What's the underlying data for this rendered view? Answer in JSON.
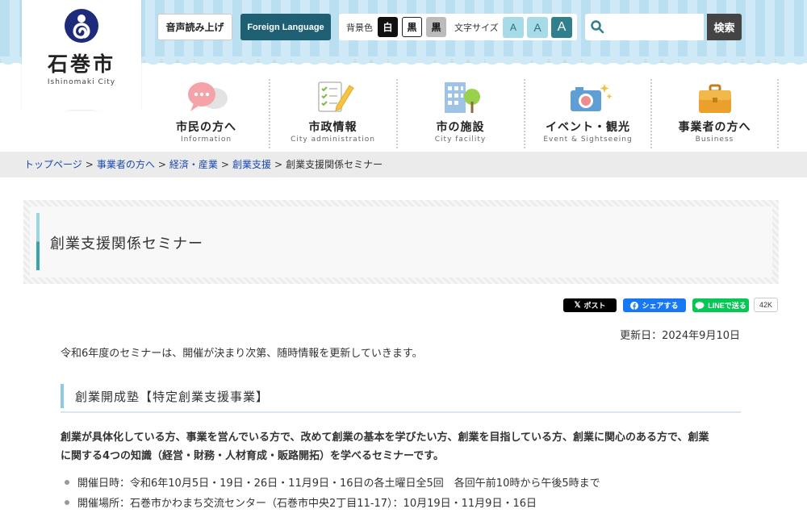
{
  "site": {
    "name": "石巻市",
    "name_en": "Ishinomaki City"
  },
  "toolbar": {
    "voice_label": "音声読み上げ",
    "foreign_label": "Foreign Language",
    "bg_label": "背景色",
    "bg_options": [
      "白",
      "黒",
      "黒"
    ],
    "size_label": "文字サイズ",
    "size_options": [
      "A",
      "A",
      "A"
    ],
    "search_placeholder": "",
    "search_button": "検索"
  },
  "nav": [
    {
      "label": "市民の方へ",
      "sub": "Information",
      "icon": "speech-bubbles-icon"
    },
    {
      "label": "市政情報",
      "sub": "City administration",
      "icon": "checklist-pencil-icon"
    },
    {
      "label": "市の施設",
      "sub": "City facility",
      "icon": "building-tree-icon"
    },
    {
      "label": "イベント・観光",
      "sub": "Event & Sightseeing",
      "icon": "camera-icon"
    },
    {
      "label": "事業者の方へ",
      "sub": "Business",
      "icon": "briefcase-icon"
    }
  ],
  "breadcrumb": {
    "items": [
      "トップページ",
      "事業者の方へ",
      "経済・産業",
      "創業支援"
    ],
    "current": "創業支援関係セミナー",
    "separator": ">"
  },
  "page": {
    "title": "創業支援関係セミナー",
    "updated": "更新日：2024年9月10日",
    "intro": "令和6年度のセミナーは、開催が決まり次第、随時情報を更新していきます。"
  },
  "social": {
    "x_label": "ポスト",
    "fb_label": "シェアする",
    "line_label": "LINEで送る",
    "count": "42K"
  },
  "section": {
    "heading": "創業開成塾【特定創業支援事業】",
    "lead_line1": "創業が具体化している方、事業を営んでいる方で、改めて創業の基本を学びたい方、創業を目指している方、創業に関心のある方で、創業",
    "lead_line2": "に関する4つの知識（経営・財務・人材育成・販路開拓）を学べるセミナーです。",
    "items": [
      "開催日時：令和6年10月5日・19日・26日・11月9日・16日の各土曜日全5回　各回午前10時から午後5時まで",
      "開催場所：石巻市かわまち交流センター（石巻市中央2丁目11-17）：10月19日・11月9日・16日"
    ]
  },
  "colors": {
    "foreign_bg": "#1f5f73",
    "link": "#1a48b0",
    "accent": "#3aa3ac",
    "facebook": "#1877f2",
    "line": "#06c755"
  }
}
